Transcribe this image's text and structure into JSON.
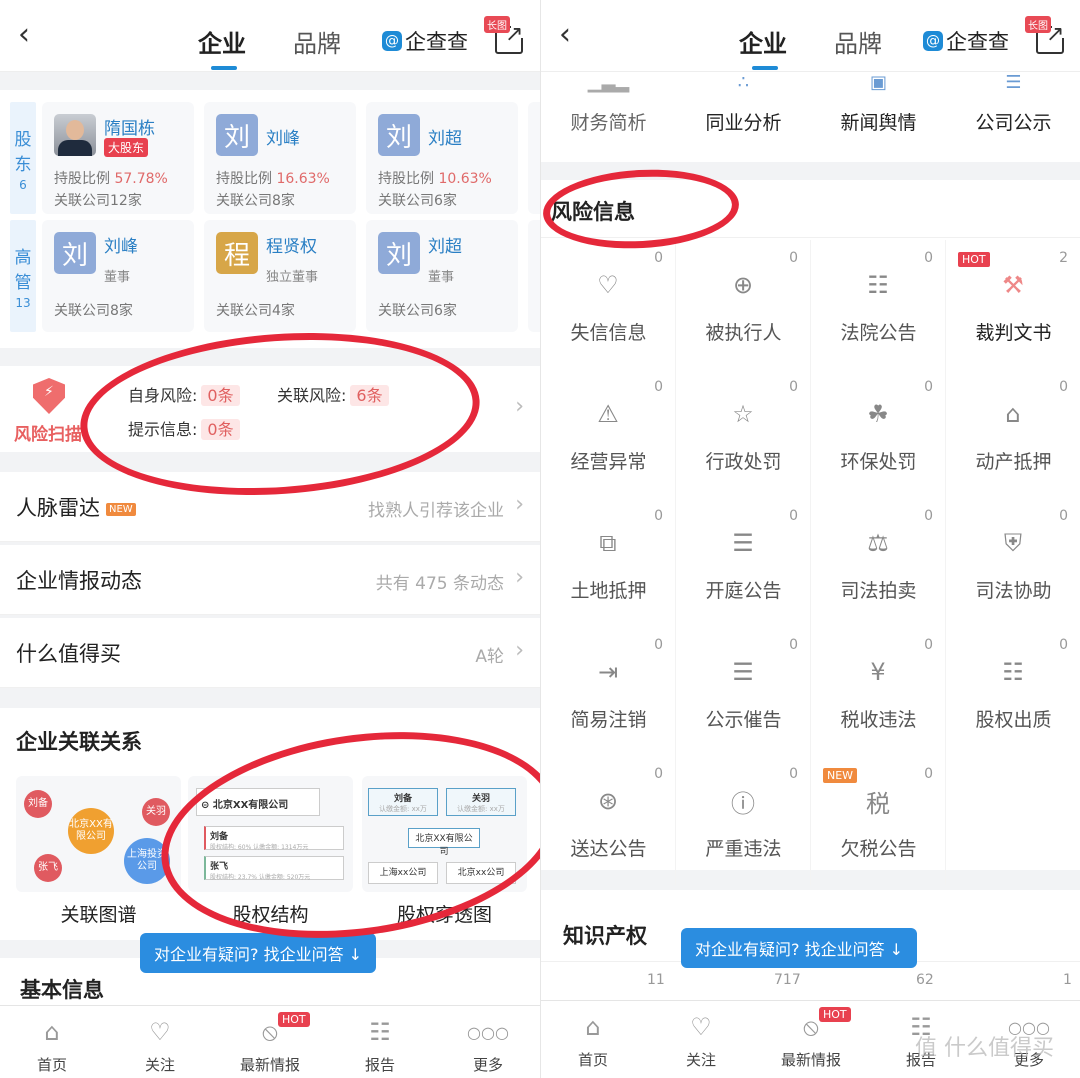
{
  "header": {
    "back_icon": "chevron-left-icon",
    "tabs": [
      {
        "label": "企业",
        "active": true
      },
      {
        "label": "品牌",
        "active": false
      }
    ],
    "brand": "企查查",
    "brand_mark": "@",
    "share_badge": "长图"
  },
  "left": {
    "shareholders": {
      "label_line1": "股",
      "label_line2": "东",
      "count": "6",
      "cards": [
        {
          "avatar": "photo",
          "name": "隋国栋",
          "badge": "大股东",
          "ratio_label": "持股比例",
          "ratio": "57.78%",
          "related": "关联公司12家"
        },
        {
          "avatar": "刘",
          "name": "刘峰",
          "ratio_label": "持股比例",
          "ratio": "16.63%",
          "related": "关联公司8家"
        },
        {
          "avatar": "刘",
          "name": "刘超",
          "ratio_label": "持股比例",
          "ratio": "10.63%",
          "related": "关联公司6家"
        }
      ]
    },
    "executives": {
      "label_line1": "高",
      "label_line2": "管",
      "count": "13",
      "cards": [
        {
          "avatar": "刘",
          "name": "刘峰",
          "role": "董事",
          "related": "关联公司8家"
        },
        {
          "avatar": "程",
          "name": "程贤权",
          "role": "独立董事",
          "related": "关联公司4家"
        },
        {
          "avatar": "刘",
          "name": "刘超",
          "role": "董事",
          "related": "关联公司6家"
        }
      ]
    },
    "risk_scan": {
      "title": "风险扫描",
      "self_risk_label": "自身风险:",
      "self_risk": "0条",
      "related_risk_label": "关联风险:",
      "related_risk": "6条",
      "hint_label": "提示信息:",
      "hint": "0条"
    },
    "rows": [
      {
        "title": "人脉雷达",
        "tag": "NEW",
        "right": "找熟人引荐该企业"
      },
      {
        "title": "企业情报动态",
        "right": "共有 475 条动态"
      },
      {
        "title": "什么值得买",
        "right": "A轮"
      }
    ],
    "relations": {
      "title": "企业关联关系",
      "items": [
        {
          "caption": "关联图谱",
          "nodes": [
            "刘备",
            "北京XX有限公司",
            "关羽",
            "张飞",
            "上海投资公司"
          ]
        },
        {
          "caption": "股权结构",
          "root": "北京XX有限公司",
          "holders": [
            {
              "name": "刘备",
              "detail": "股权结构: 60%  认缴金额: 1314万元"
            },
            {
              "name": "张飞",
              "detail": "股权结构: 23.7%  认缴金额: 520万元"
            }
          ]
        },
        {
          "caption": "股权穿透图",
          "top": [
            {
              "name": "刘备",
              "sub": "认缴金额: xx万"
            },
            {
              "name": "关羽",
              "sub": "认缴金额: xx万"
            }
          ],
          "center": "北京XX有限公司",
          "bottom": [
            "上海xx公司",
            "北京xx公司"
          ]
        }
      ]
    },
    "basic_info_title": "基本信息"
  },
  "qa_button": "对企业有疑问? 找企业问答 ↓",
  "bottom_nav": [
    {
      "label": "首页",
      "icon": "home-icon"
    },
    {
      "label": "关注",
      "icon": "heart-icon"
    },
    {
      "label": "最新情报",
      "icon": "compass-icon",
      "badge": "HOT"
    },
    {
      "label": "报告",
      "icon": "report-icon"
    },
    {
      "label": "更多",
      "icon": "more-icon"
    }
  ],
  "right": {
    "quick": [
      {
        "label": "财务简析"
      },
      {
        "label": "同业分析"
      },
      {
        "label": "新闻舆情"
      },
      {
        "label": "公司公示"
      }
    ],
    "risk_title": "风险信息",
    "risk_items": [
      {
        "label": "失信信息",
        "count": "0",
        "icon": "broken-heart-icon"
      },
      {
        "label": "被执行人",
        "count": "0",
        "icon": "target-person-icon"
      },
      {
        "label": "法院公告",
        "count": "0",
        "icon": "document-icon"
      },
      {
        "label": "裁判文书",
        "count": "2",
        "icon": "gavel-icon",
        "tag": "HOT"
      },
      {
        "label": "经营异常",
        "count": "0",
        "icon": "warning-icon"
      },
      {
        "label": "行政处罚",
        "count": "0",
        "icon": "star-clipboard-icon"
      },
      {
        "label": "环保处罚",
        "count": "0",
        "icon": "leaf-icon"
      },
      {
        "label": "动产抵押",
        "count": "0",
        "icon": "house-search-icon"
      },
      {
        "label": "土地抵押",
        "count": "0",
        "icon": "land-icon"
      },
      {
        "label": "开庭公告",
        "count": "0",
        "icon": "list-icon"
      },
      {
        "label": "司法拍卖",
        "count": "0",
        "icon": "auction-icon"
      },
      {
        "label": "司法协助",
        "count": "0",
        "icon": "shield-link-icon"
      },
      {
        "label": "简易注销",
        "count": "0",
        "icon": "exit-icon"
      },
      {
        "label": "公示催告",
        "count": "0",
        "icon": "clipboard-list-icon"
      },
      {
        "label": "税收违法",
        "count": "0",
        "icon": "yen-doc-icon"
      },
      {
        "label": "股权出质",
        "count": "0",
        "icon": "pledge-doc-icon"
      },
      {
        "label": "送达公告",
        "count": "0",
        "icon": "seal-doc-icon"
      },
      {
        "label": "严重违法",
        "count": "0",
        "icon": "shield-alert-icon"
      },
      {
        "label": "欠税公告",
        "count": "0",
        "icon": "tax-icon",
        "tag": "NEW"
      }
    ],
    "ip_title": "知识产权",
    "ip_counts": [
      "11",
      "717",
      "62",
      "1"
    ]
  },
  "watermark": "值 什么值得买"
}
